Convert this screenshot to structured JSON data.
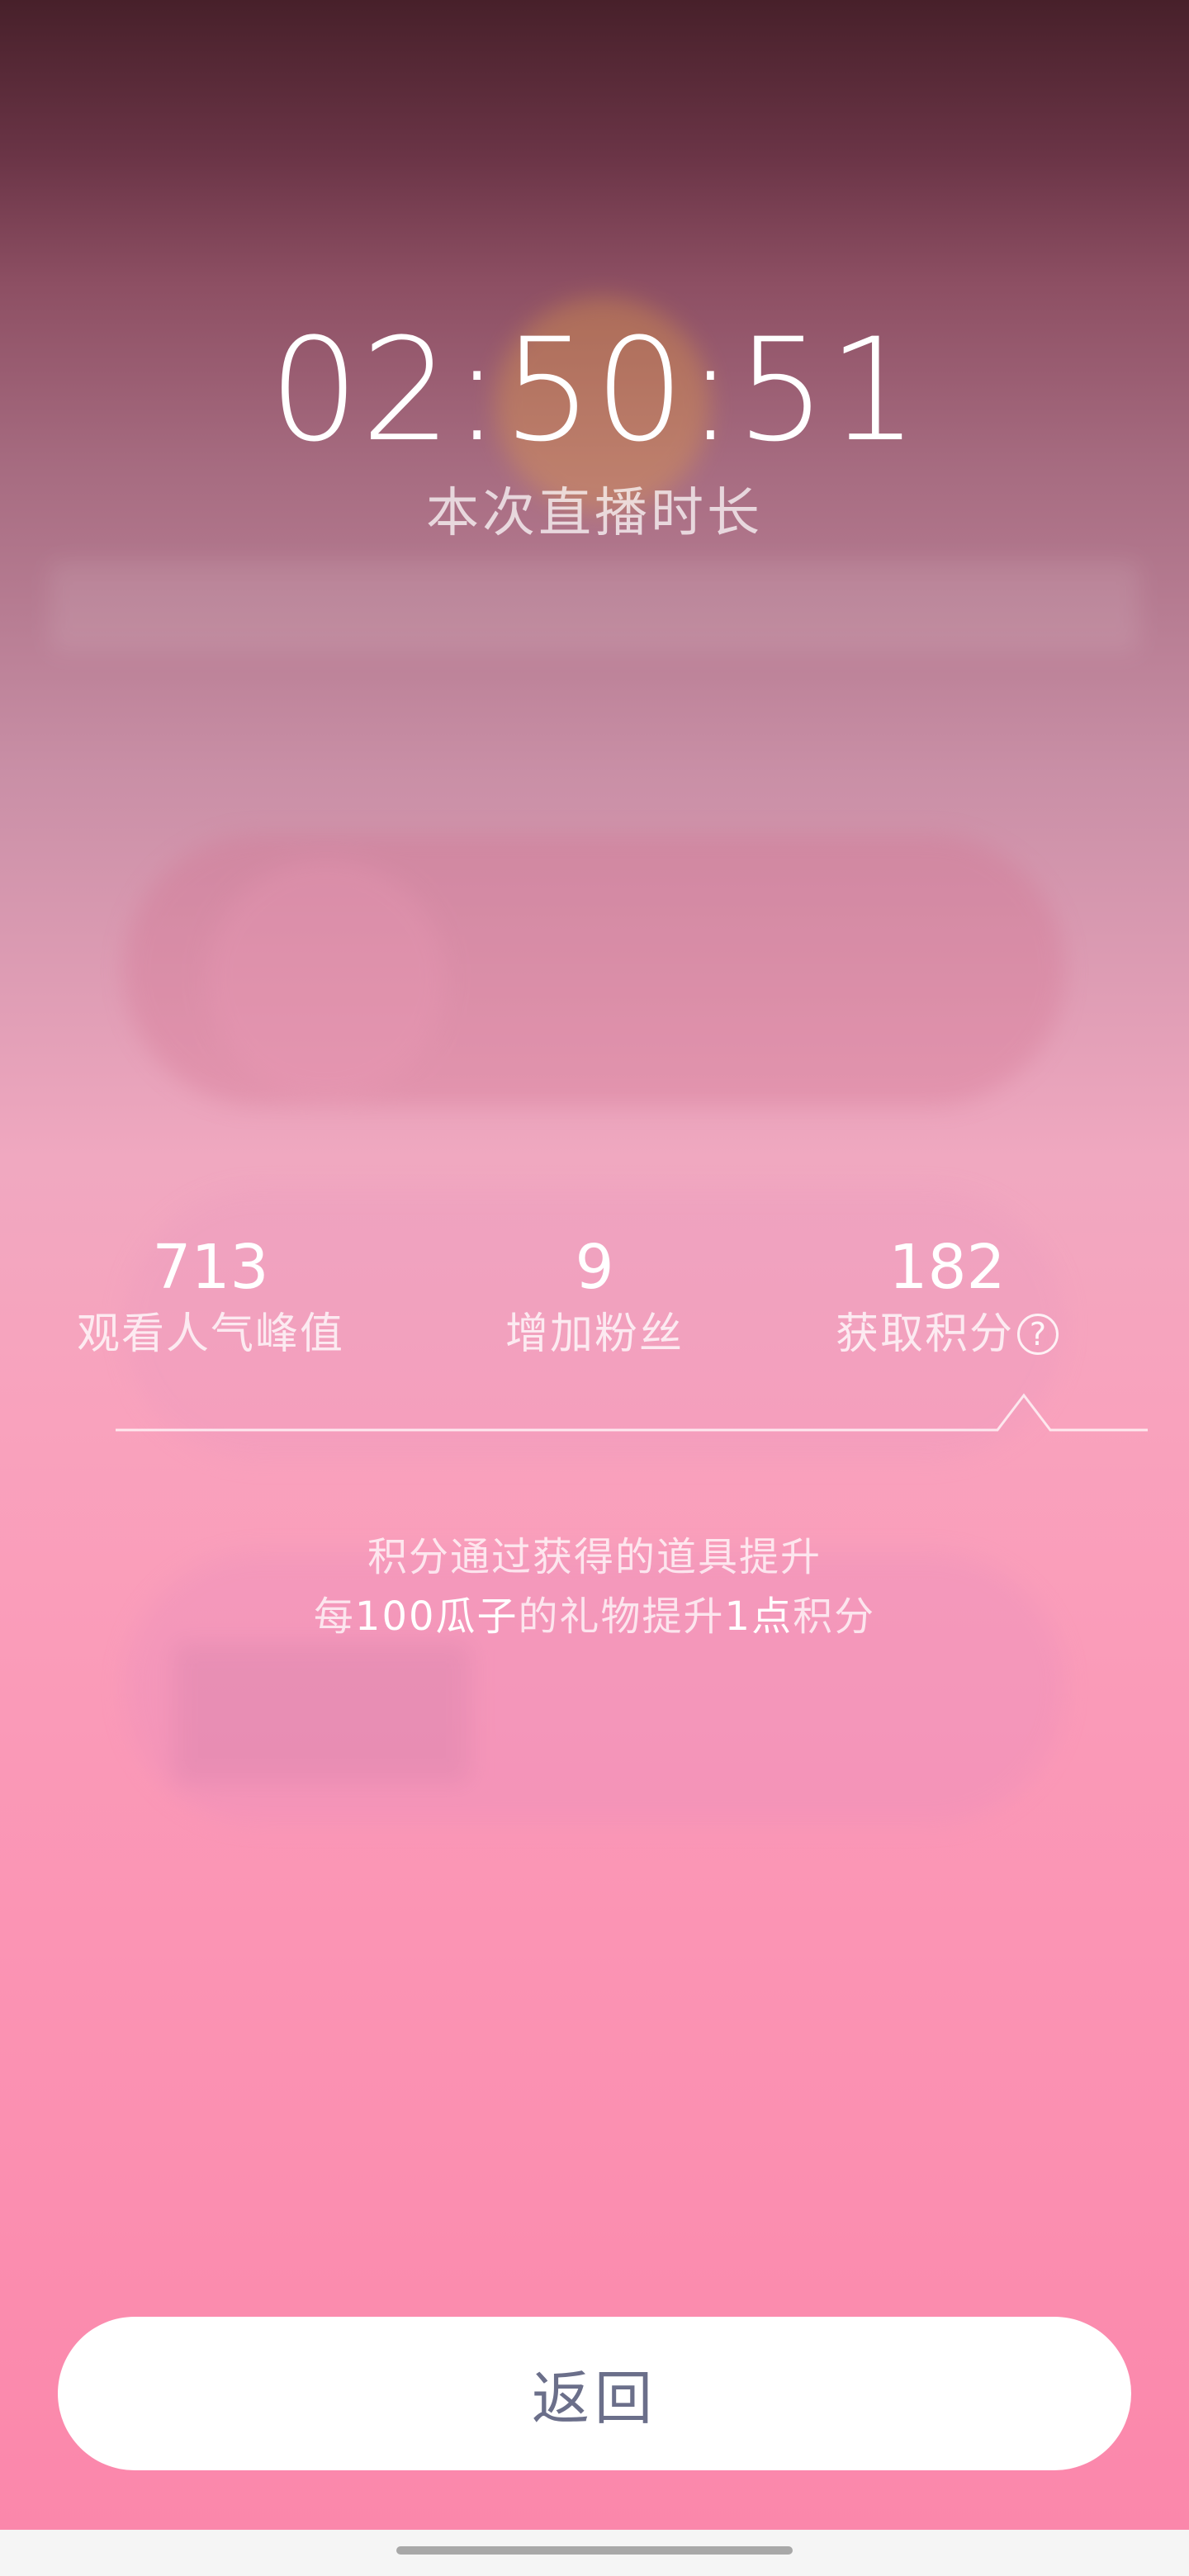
{
  "live_summary": {
    "duration": "02:50:51",
    "duration_label": "本次直播时长"
  },
  "stats": [
    {
      "value": "713",
      "label": "观看人气峰值"
    },
    {
      "value": "9",
      "label": "增加粉丝"
    },
    {
      "value": "182",
      "label": "获取积分"
    }
  ],
  "help_icon_glyph": "?",
  "points_info": {
    "line1": "积分通过获得的道具提升",
    "line2_a": "每",
    "line2_b": "100瓜子",
    "line2_c": "的礼物提升",
    "line2_d": "1点",
    "line2_e": "积分"
  },
  "back_button_label": "返回",
  "colors": {
    "bg_top": "#47202a",
    "bg_bottom": "#fb86aa",
    "button_text": "#6b6f8a"
  }
}
